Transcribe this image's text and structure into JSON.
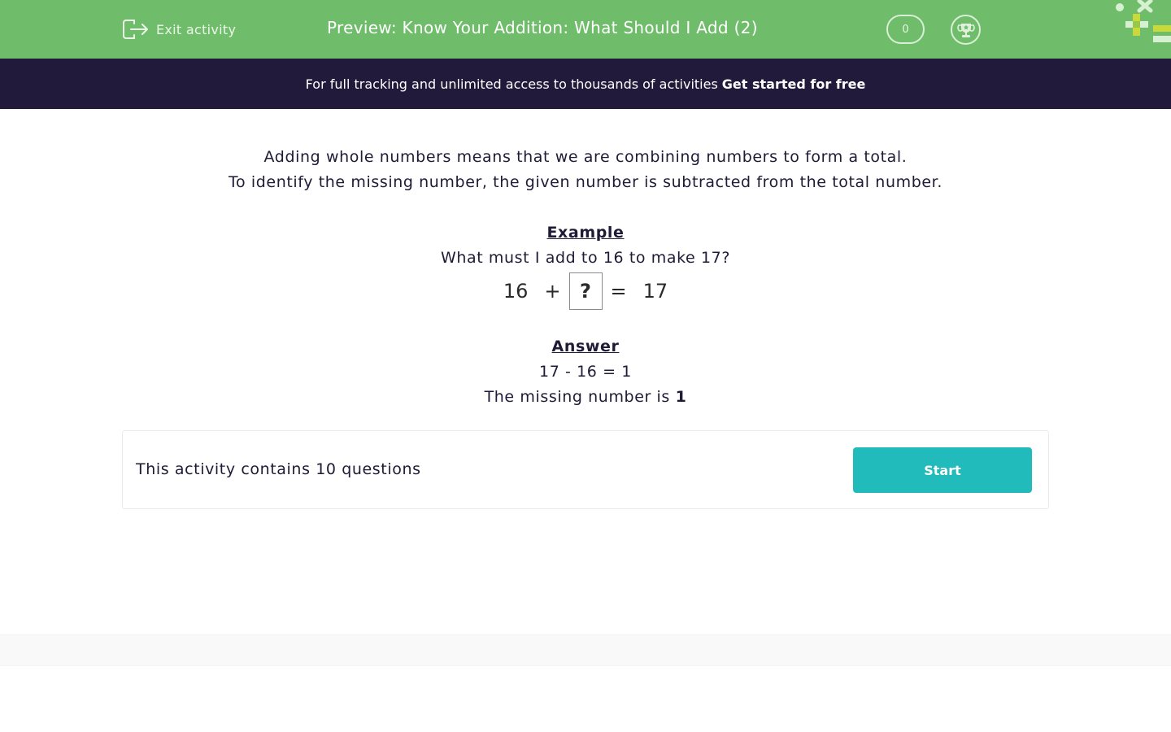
{
  "header": {
    "exit_label": "Exit activity",
    "title": "Preview: Know Your Addition: What Should I Add (2)",
    "score": "0",
    "colors": {
      "bar": "#6fbd6a",
      "banner": "#211a3b",
      "accent": "#22bbbb"
    }
  },
  "banner": {
    "text": "For full tracking and unlimited access to thousands of activities",
    "cta": "Get started for free"
  },
  "intro": {
    "line1": "Adding whole numbers means that we are combining numbers to form a total.",
    "line2": "To identify the missing number, the given number is subtracted from the total number."
  },
  "example": {
    "heading": "Example",
    "question": "What must I add to 16 to make 17?",
    "equation": {
      "a": "16",
      "op": "+",
      "unknown": "?",
      "eq": "=",
      "total": "17"
    }
  },
  "answer": {
    "heading": "Answer",
    "calc": "17 - 16 = 1",
    "statement_prefix": "The missing number is",
    "value": "1"
  },
  "card": {
    "text": "This activity contains 10 questions",
    "start_label": "Start"
  }
}
